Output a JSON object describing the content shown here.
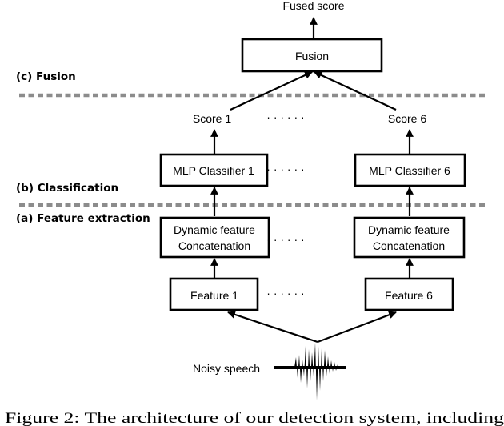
{
  "diagram": {
    "output_label": "Fused score",
    "fusion_box": "Fusion",
    "stage_labels": {
      "fusion": "(c) Fusion",
      "classification": "(b) Classification",
      "feature_extraction": "(a) Feature extraction"
    },
    "scores": [
      "Score 1",
      "Score 6"
    ],
    "classifiers": [
      "MLP Classifier 1",
      "MLP Classifier 6"
    ],
    "concatenation": [
      {
        "line1": "Dynamic feature",
        "line2": "Concatenation"
      },
      {
        "line1": "Dynamic feature",
        "line2": "Concatenation"
      }
    ],
    "features": [
      "Feature 1",
      "Feature 6"
    ],
    "ellipsis": "· · · · · ·",
    "input_label": "Noisy speech",
    "separator_color": "#8c8c8c"
  },
  "caption": "Figure 2: The architecture of our detection system, including"
}
